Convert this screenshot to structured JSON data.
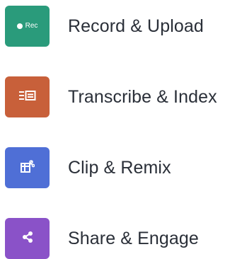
{
  "features": [
    {
      "label": "Record & Upload",
      "icon": "record-icon",
      "icon_text": "Rec",
      "color": "#2a9b7b"
    },
    {
      "label": "Transcribe & Index",
      "icon": "transcript-icon",
      "color": "#c8603a"
    },
    {
      "label": "Clip & Remix",
      "icon": "clip-icon",
      "color": "#4f6fd6"
    },
    {
      "label": "Share & Engage",
      "icon": "share-icon",
      "color": "#8a52c8"
    }
  ]
}
